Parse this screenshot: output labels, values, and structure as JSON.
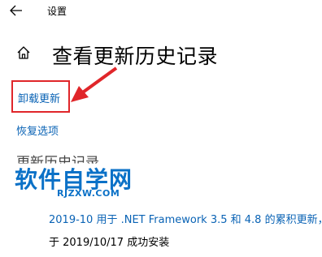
{
  "window": {
    "title": "设置"
  },
  "page": {
    "title": "查看更新历史记录"
  },
  "links": {
    "uninstall": "卸载更新",
    "recovery": "恢复选项"
  },
  "section": {
    "heading": "更新历史记录"
  },
  "watermark": {
    "main": "软件自学网",
    "sub": "RJZXW.COM"
  },
  "update": {
    "title": "2019-10 用于 .NET Framework 3.5 和 4.8 的累积更新，适",
    "status": "于 2019/10/17 成功安装"
  },
  "colors": {
    "link": "#0a63b5",
    "annotation": "#e0262a",
    "watermark": "#0b71c7"
  }
}
